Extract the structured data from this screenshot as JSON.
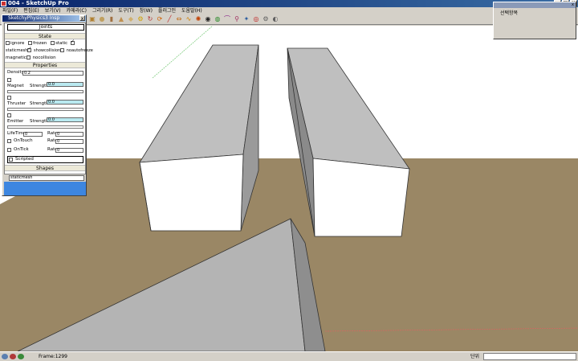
{
  "window": {
    "title": "004 - SketchUp Pro"
  },
  "menu": [
    "파일(F)",
    "편집(E)",
    "보기(V)",
    "카메라(C)",
    "그리기(R)",
    "도구(T)",
    "창(W)",
    "플러그인",
    "도움말(H)"
  ],
  "toolbar_icons": [
    "select-icon",
    "eraser-icon",
    "paint-icon",
    "rectangle-icon",
    "pushpull-icon",
    "play-icon",
    "pause-icon",
    "stop-icon",
    "reset-icon",
    "box-icon",
    "sphere-icon",
    "cylinder-icon",
    "cone-icon",
    "cube-icon",
    "joint-icon",
    "hinge-icon",
    "servo-icon",
    "line-icon",
    "slider-icon",
    "spring-icon",
    "gear-icon",
    "ball-icon",
    "globe-icon",
    "magnet-icon",
    "pin-icon",
    "wand-icon",
    "record-icon",
    "settings-icon",
    "eye-icon"
  ],
  "physics_panel": {
    "title": "SketchyPhysics3 Insp",
    "close_label": "x",
    "joints_label": "Joints",
    "state_header": "State",
    "state_row1": {
      "ignore": "ignore",
      "frozen": "frozen",
      "static": "static"
    },
    "state_row2": {
      "staticmesh": "staticmesh",
      "showcollision": "showcollision",
      "noautofreeze": "noautofreeze"
    },
    "state_row3": {
      "magnetic": "magnetic",
      "nocollision": "nocollision"
    },
    "properties_header": "Properties",
    "density_label": "Density",
    "density_value": "0.2",
    "magnet_label": "Magnet",
    "magnet_strength_label": "Strength",
    "magnet_strength_value": "0.0",
    "thruster_label": "Thruster",
    "thruster_strength_label": "Strength",
    "thruster_strength_value": "0.0",
    "emitter_label": "Emitter",
    "emitter_strength_label": "Strength",
    "emitter_strength_value": "0.0",
    "lifetime_label": "LifeTime",
    "lifetime_value": "0",
    "rate_label": "Rate",
    "rate_value": "0",
    "ontouch_label": "OnTouch",
    "ontouch_rate_label": "Rate",
    "ontouch_rate_value": "0",
    "ontick_label": "OnTick",
    "ontick_rate_label": "Rate",
    "ontick_rate_value": "0",
    "scripted_label": "Scripted",
    "shapes_header": "Shapes",
    "shape_value": "staticmesh"
  },
  "selection_panel": {
    "title": "선택항목",
    "close_label": "x"
  },
  "status": {
    "text": "Frame:1299",
    "measure_label": "단위"
  },
  "colors": {
    "ground": "#9a8765",
    "box_top": "#bfbfbf",
    "box_side": "#e2e2e2",
    "prism_face": "#b4b4b4",
    "prism_side": "#8e8e8e"
  }
}
